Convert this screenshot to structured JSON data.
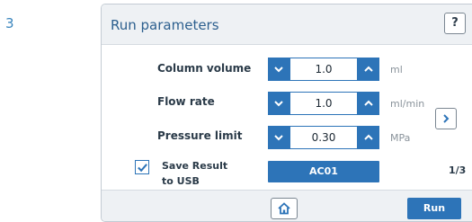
{
  "step_number": "3",
  "header": {
    "title": "Run parameters",
    "help_label": "?"
  },
  "parameters": [
    {
      "label": "Column volume",
      "value": "1.0",
      "unit": "ml"
    },
    {
      "label": "Flow rate",
      "value": "1.0",
      "unit": "ml/min"
    },
    {
      "label": "Pressure limit",
      "value": "0.30",
      "unit": "MPa"
    }
  ],
  "save_result": {
    "checked": true,
    "label_line1": "Save Result",
    "label_line2": "to USB",
    "usb_name": "AC01"
  },
  "page_indicator": "1/3",
  "footer": {
    "run_label": "Run"
  },
  "colors": {
    "accent": "#2d74b8",
    "title": "#2c5f8e",
    "header_bg": "#eef1f4",
    "step_number": "#3a85bd"
  },
  "icons": {
    "decrement": "chevron-down-icon",
    "increment": "chevron-up-icon",
    "next": "chevron-right-icon",
    "home": "home-icon",
    "check": "checkmark-icon"
  }
}
